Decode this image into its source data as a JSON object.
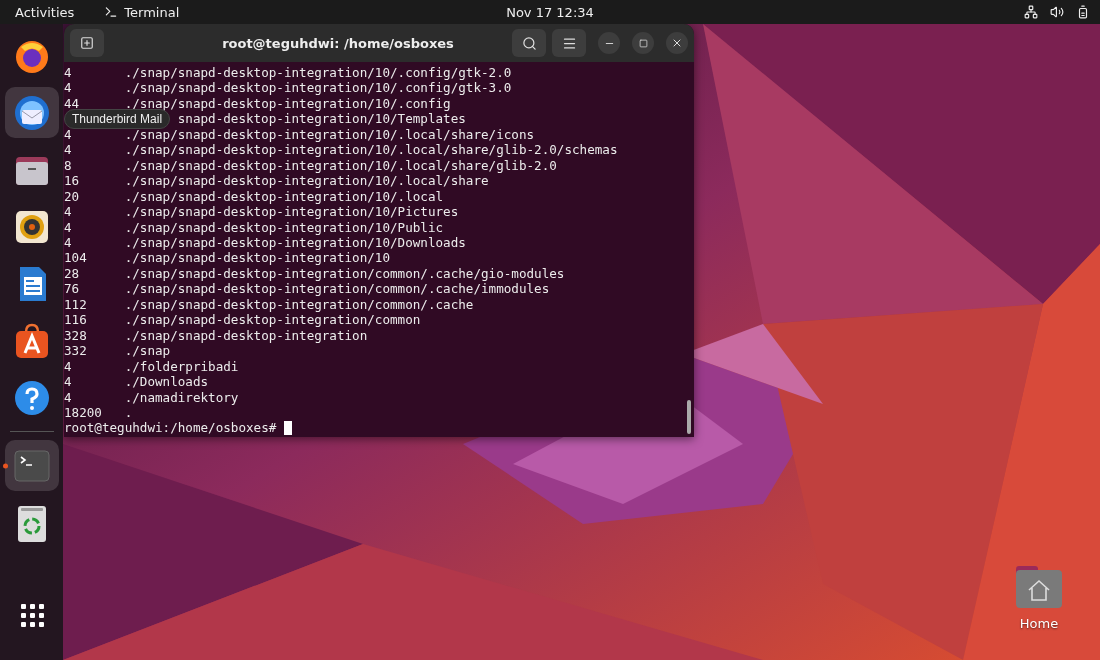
{
  "top_bar": {
    "activities": "Activities",
    "app_name": "Terminal",
    "clock": "Nov 17  12:34"
  },
  "dock": {
    "items": [
      {
        "kind": "browser",
        "highlighted": false,
        "running": false
      },
      {
        "kind": "mail",
        "highlighted": true,
        "running": false
      },
      {
        "kind": "files",
        "highlighted": false,
        "running": false
      },
      {
        "kind": "music",
        "highlighted": false,
        "running": false
      },
      {
        "kind": "writer",
        "highlighted": false,
        "running": false
      },
      {
        "kind": "store",
        "highlighted": false,
        "running": false
      },
      {
        "kind": "help",
        "highlighted": false,
        "running": false
      },
      {
        "kind": "separator"
      },
      {
        "kind": "terminal",
        "highlighted": true,
        "running": true
      },
      {
        "kind": "trash",
        "highlighted": false,
        "running": false
      },
      {
        "kind": "apps",
        "highlighted": false,
        "running": false
      }
    ],
    "tooltip": "Thunderbird Mail"
  },
  "terminal": {
    "title": "root@teguhdwi: /home/osboxes",
    "lines": [
      {
        "kind": "full",
        "size": "4",
        "path": "./snap/snapd-desktop-integration/10/.config/gtk-2.0"
      },
      {
        "kind": "full",
        "size": "4",
        "path": "./snap/snapd-desktop-integration/10/.config/gtk-3.0"
      },
      {
        "kind": "full",
        "size": "44",
        "path": "./snap/snapd-desktop-integration/10/.config"
      },
      {
        "kind": "partial",
        "path": "snapd-desktop-integration/10/Templates"
      },
      {
        "kind": "full",
        "size": "4",
        "path": "./snap/snapd-desktop-integration/10/.local/share/icons"
      },
      {
        "kind": "full",
        "size": "4",
        "path": "./snap/snapd-desktop-integration/10/.local/share/glib-2.0/schemas"
      },
      {
        "kind": "full",
        "size": "8",
        "path": "./snap/snapd-desktop-integration/10/.local/share/glib-2.0"
      },
      {
        "kind": "full",
        "size": "16",
        "path": "./snap/snapd-desktop-integration/10/.local/share"
      },
      {
        "kind": "full",
        "size": "20",
        "path": "./snap/snapd-desktop-integration/10/.local"
      },
      {
        "kind": "full",
        "size": "4",
        "path": "./snap/snapd-desktop-integration/10/Pictures"
      },
      {
        "kind": "full",
        "size": "4",
        "path": "./snap/snapd-desktop-integration/10/Public"
      },
      {
        "kind": "full",
        "size": "4",
        "path": "./snap/snapd-desktop-integration/10/Downloads"
      },
      {
        "kind": "full",
        "size": "104",
        "path": "./snap/snapd-desktop-integration/10"
      },
      {
        "kind": "full",
        "size": "28",
        "path": "./snap/snapd-desktop-integration/common/.cache/gio-modules"
      },
      {
        "kind": "full",
        "size": "76",
        "path": "./snap/snapd-desktop-integration/common/.cache/immodules"
      },
      {
        "kind": "full",
        "size": "112",
        "path": "./snap/snapd-desktop-integration/common/.cache"
      },
      {
        "kind": "full",
        "size": "116",
        "path": "./snap/snapd-desktop-integration/common"
      },
      {
        "kind": "full",
        "size": "328",
        "path": "./snap/snapd-desktop-integration"
      },
      {
        "kind": "full",
        "size": "332",
        "path": "./snap"
      },
      {
        "kind": "full",
        "size": "4",
        "path": "./folderpribadi"
      },
      {
        "kind": "full",
        "size": "4",
        "path": "./Downloads"
      },
      {
        "kind": "full",
        "size": "4",
        "path": "./namadirektory"
      },
      {
        "kind": "full",
        "size": "18200",
        "path": "."
      }
    ],
    "prompt": "root@teguhdwi:/home/osboxes#"
  },
  "desktop": {
    "icons": [
      {
        "label": "Home"
      }
    ]
  }
}
